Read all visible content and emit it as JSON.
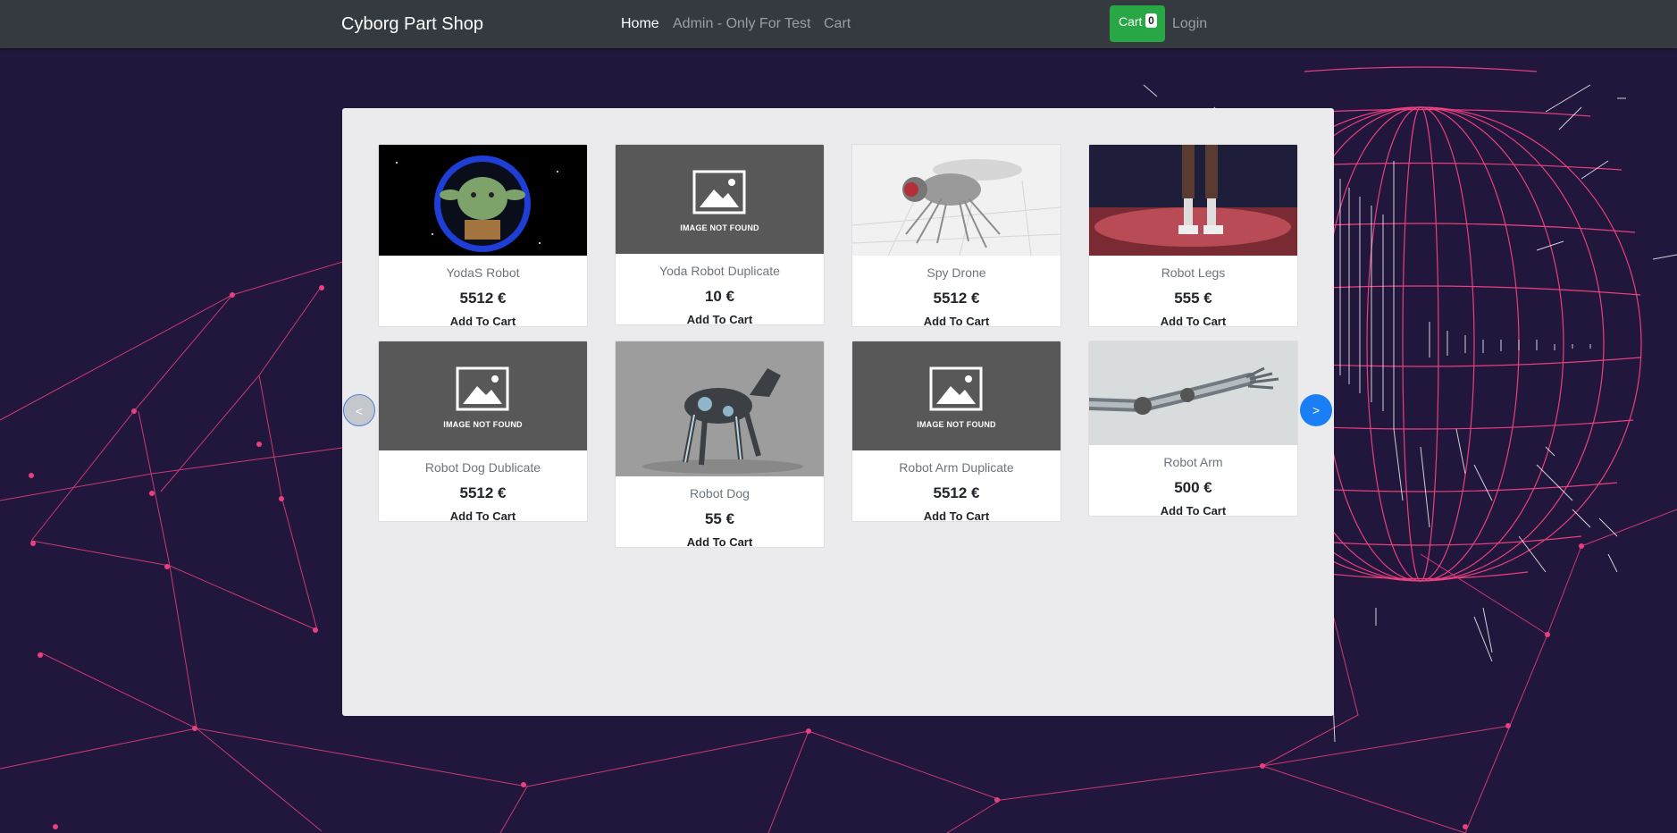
{
  "brand": "Cyborg Part Shop",
  "nav": {
    "home": "Home",
    "admin": "Admin - Only For Test",
    "cart": "Cart",
    "login": "Login"
  },
  "cart_button": {
    "label": "Cart",
    "count": "0"
  },
  "carousel": {
    "prev": "<",
    "next": ">"
  },
  "placeholder_text": "IMAGE NOT FOUND",
  "add_to_cart_label": "Add To Cart",
  "products": [
    {
      "name": "YodaS Robot",
      "price": "5512 €",
      "image": "yoda-icon"
    },
    {
      "name": "Yoda Robot Duplicate",
      "price": "10 €",
      "image": "image-not-found"
    },
    {
      "name": "Spy Drone",
      "price": "5512 €",
      "image": "robot-fly-icon"
    },
    {
      "name": "Robot Legs",
      "price": "555 €",
      "image": "robot-legs-icon"
    },
    {
      "name": "Robot Dog Dublicate",
      "price": "5512 €",
      "image": "image-not-found"
    },
    {
      "name": "Robot Dog",
      "price": "55 €",
      "image": "robot-dog-icon"
    },
    {
      "name": "Robot Arm Duplicate",
      "price": "5512 €",
      "image": "image-not-found"
    },
    {
      "name": "Robot Arm",
      "price": "500 €",
      "image": "robot-arm-icon"
    }
  ],
  "colors": {
    "background": "#21163c",
    "navbar": "#343a40",
    "mesh": "#e8407f",
    "cart_button": "#28a745",
    "carousel_next": "#1a7ef5"
  }
}
